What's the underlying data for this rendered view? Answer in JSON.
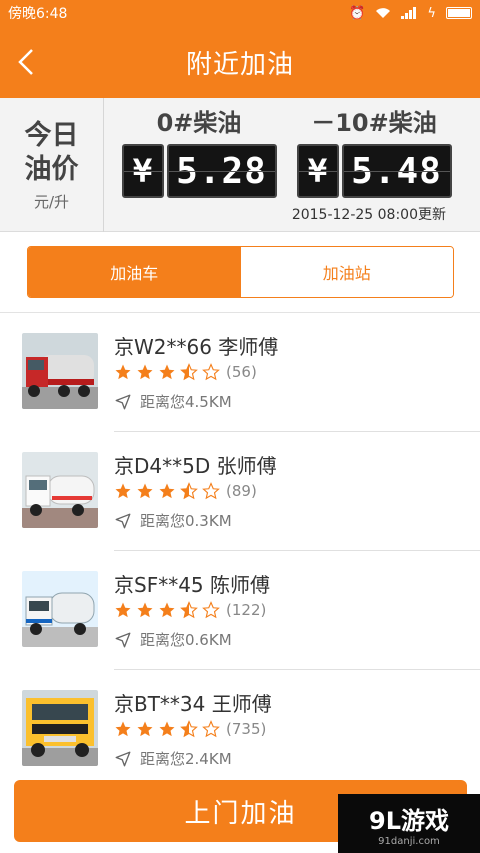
{
  "status_bar": {
    "carrier_time": "傍晚6:48"
  },
  "nav": {
    "title": "附近加油"
  },
  "price_panel": {
    "today_label": "今日油价",
    "unit": "元/升",
    "fuels": [
      {
        "name": "0#柴油",
        "currency": "¥",
        "price": "5.28"
      },
      {
        "name": "－10#柴油",
        "currency": "¥",
        "price": "5.48"
      }
    ],
    "update_time": "2015-12-25 08:00更新"
  },
  "tabs": [
    {
      "label": "加油车",
      "active": true
    },
    {
      "label": "加油站",
      "active": false
    }
  ],
  "list": [
    {
      "plate_driver": "京W2**66 李师傅",
      "rating": 3.5,
      "rating_count": "(56)",
      "distance": "距离您4.5KM",
      "truck_color": "red"
    },
    {
      "plate_driver": "京D4**5D 张师傅",
      "rating": 3.5,
      "rating_count": "(89)",
      "distance": "距离您0.3KM",
      "truck_color": "white"
    },
    {
      "plate_driver": "京SF**45 陈师傅",
      "rating": 3.5,
      "rating_count": "(122)",
      "distance": "距离您0.6KM",
      "truck_color": "white-blue"
    },
    {
      "plate_driver": "京BT**34 王师傅",
      "rating": 3.5,
      "rating_count": "(735)",
      "distance": "距离您2.4KM",
      "truck_color": "yellow"
    }
  ],
  "cta": {
    "label": "上门加油"
  },
  "watermark": {
    "main": "9L游戏",
    "sub": "91danji.com"
  },
  "colors": {
    "accent": "#f47f1b",
    "star": "#f47f1b"
  }
}
